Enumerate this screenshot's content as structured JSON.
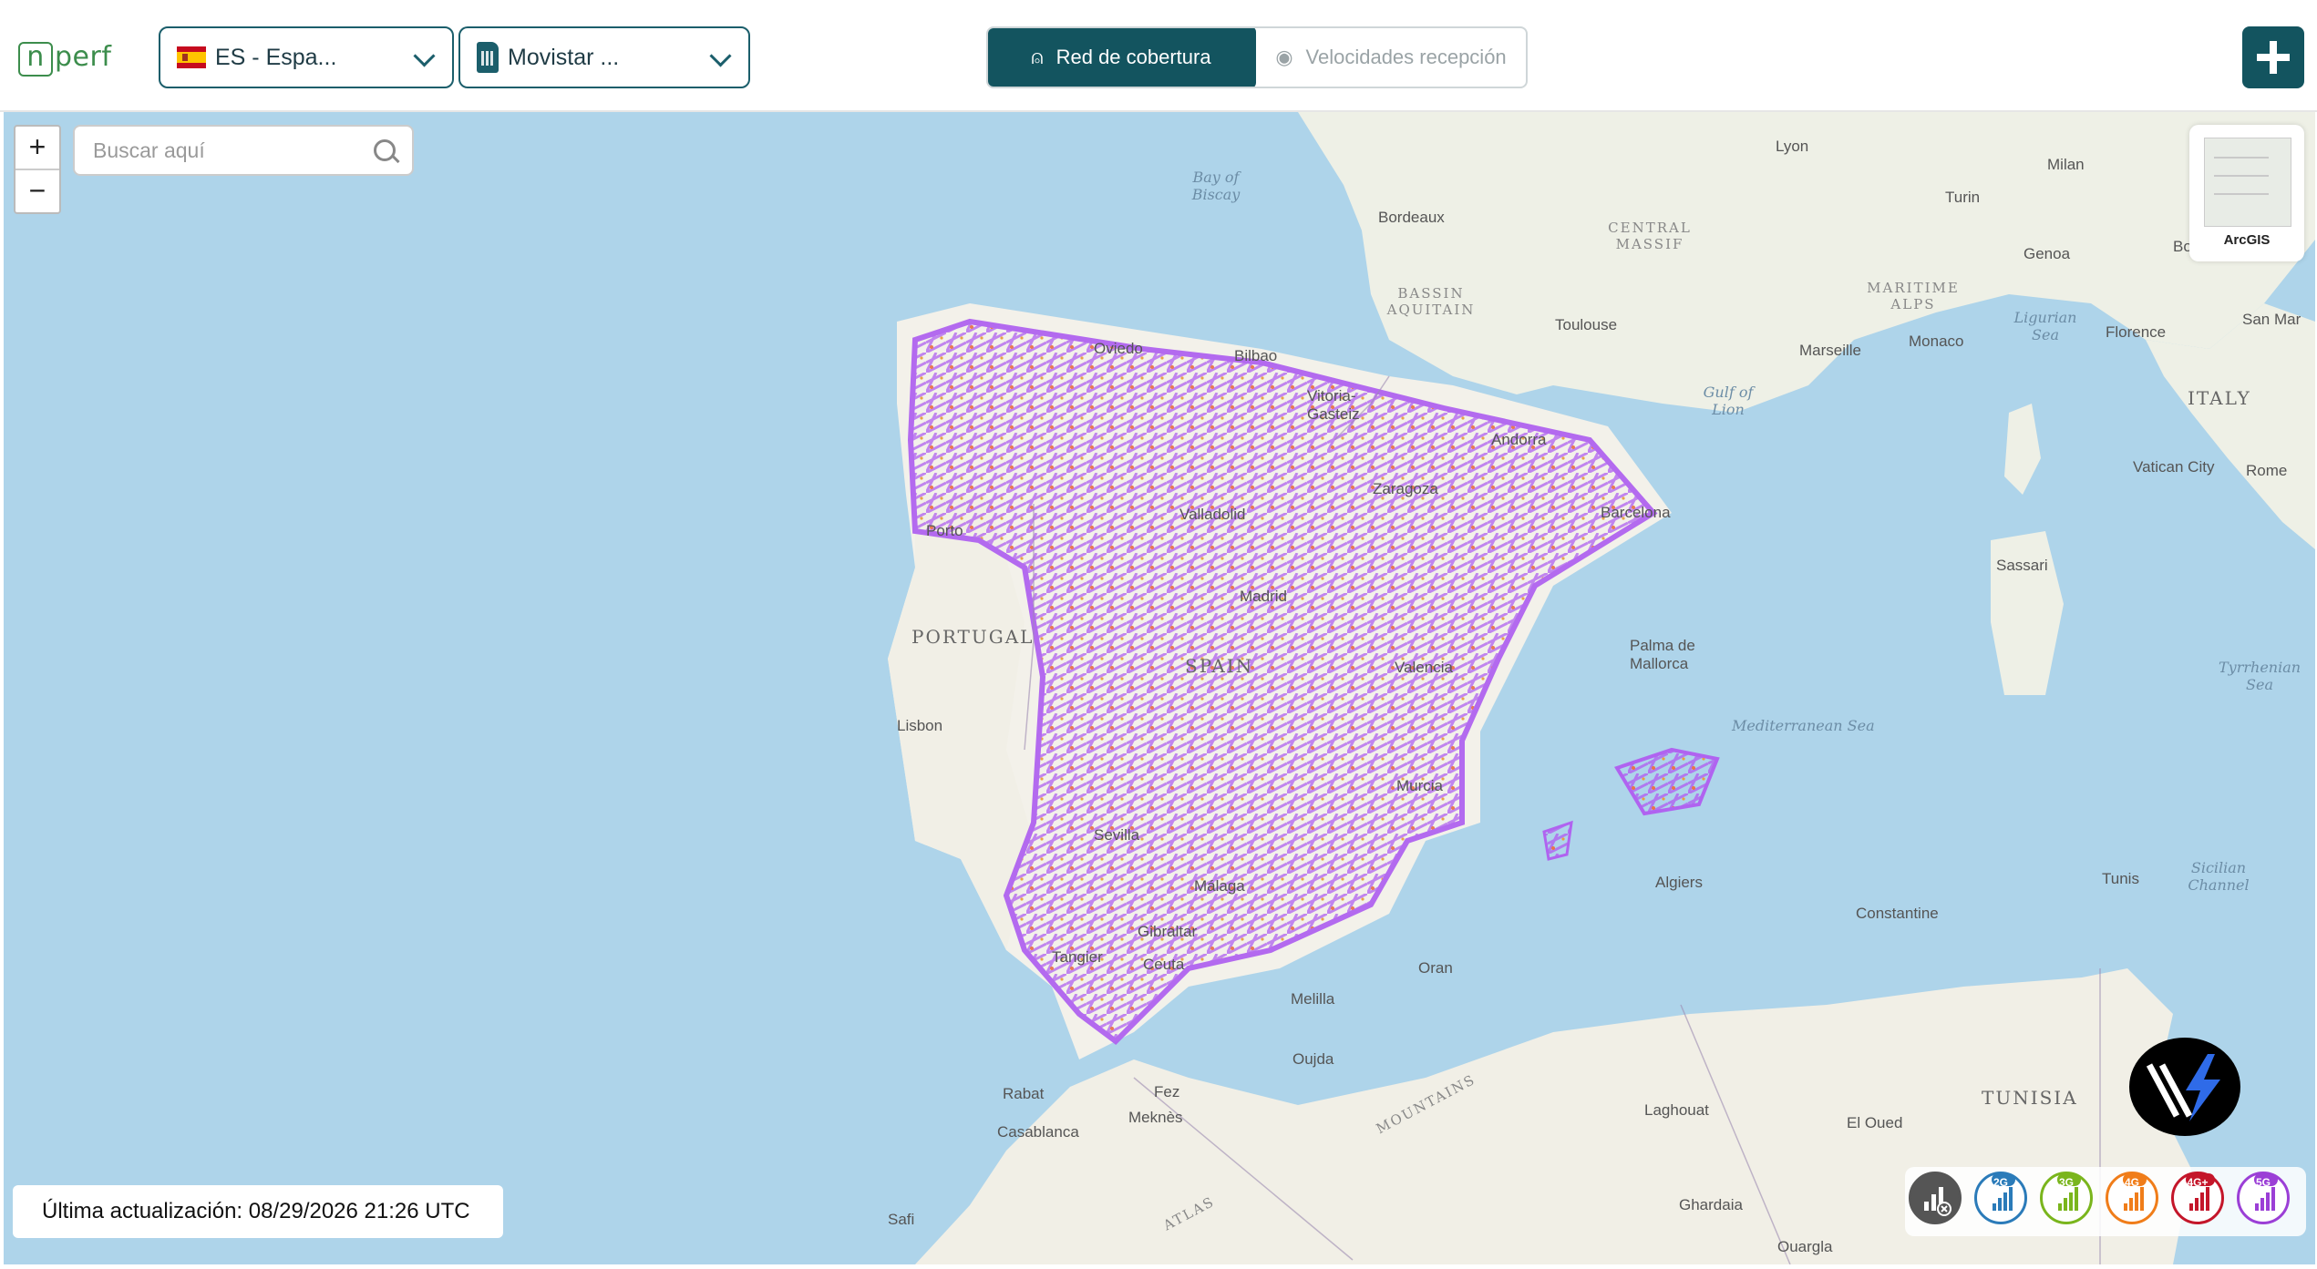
{
  "header": {
    "logo_text": "nperf",
    "country_select": "ES - Espa...",
    "operator_select": "Movistar ...",
    "tab_coverage": "Red de cobertura",
    "tab_speeds": "Velocidades recepción"
  },
  "map": {
    "search_placeholder": "Buscar aquí",
    "zoom_in": "+",
    "zoom_out": "−",
    "basemap_label": "ArcGIS",
    "last_update": "Última actualización: 08/29/2026 21:26 UTC",
    "labels": {
      "lyon": "Lyon",
      "milan": "Milan",
      "turin": "Turin",
      "genoa": "Genoa",
      "bordeaux": "Bordeaux",
      "central_massif": "CENTRAL MASSIF",
      "bay_of_biscay": "Bay of Biscay",
      "bassin": "BASSIN AQUITAIN",
      "toulouse": "Toulouse",
      "marseille": "Marseille",
      "monaco": "Monaco",
      "florence": "Florence",
      "ligurian_sea": "Ligurian Sea",
      "maritime_alps": "MARITIME ALPS",
      "italy": "ITALY",
      "gulf_of_lion": "Gulf of Lion",
      "andorra": "Andorra",
      "vatican": "Vatican City",
      "rome": "Rome",
      "oviedo": "Oviedo",
      "bilbao": "Bilbao",
      "vitoria": "Vitoria-Gasteiz",
      "zaragoza": "Zaragoza",
      "barcelona": "Barcelona",
      "porto": "Porto",
      "valladolid": "Valladolid",
      "sassari": "Sassari",
      "portugal": "PORTUGAL",
      "madrid": "Madrid",
      "spain": "SPAIN",
      "palma": "Palma de Mallorca",
      "valencia": "Valencia",
      "lisbon": "Lisbon",
      "mediterranean": "Mediterranean Sea",
      "tyrrhenian": "Tyrrhenian Sea",
      "murcia": "Murcia",
      "sevilla": "Sevilla",
      "algiers": "Algiers",
      "tunis": "Tunis",
      "malaga": "Málaga",
      "gibraltar": "Gibraltar",
      "constantine": "Constantine",
      "sicilian": "Sicilian Channel",
      "tangier": "Tangier",
      "ceuta": "Ceuta",
      "oran": "Oran",
      "melilla": "Melilla",
      "oujda": "Oujda",
      "rabat": "Rabat",
      "fez": "Fez",
      "meknes": "Meknès",
      "casablanca": "Casablanca",
      "laghouat": "Laghouat",
      "el_oued": "El Oued",
      "tunisia": "TUNISIA",
      "safi": "Safi",
      "ghardaia": "Ghardaia",
      "ouargla": "Ouargla",
      "san_marino": "San Mar",
      "bo": "Bo",
      "atlas": "ATLAS",
      "mountains": "MOUNTAINS"
    }
  },
  "legend": [
    {
      "name": "all",
      "label": "",
      "color": "#555555"
    },
    {
      "name": "2g",
      "label": "2G",
      "color": "#2b7bb9"
    },
    {
      "name": "3g",
      "label": "3G",
      "color": "#7ab51d"
    },
    {
      "name": "4g",
      "label": "4G",
      "color": "#f07d1a"
    },
    {
      "name": "4gplus",
      "label": "4G+",
      "color": "#c4162a"
    },
    {
      "name": "5g",
      "label": "5G",
      "color": "#9b3fd6"
    }
  ],
  "colors": {
    "primary": "#13545f",
    "coverage": "#b063f0",
    "sea": "#aed4ea",
    "land": "#f3f1ea"
  }
}
